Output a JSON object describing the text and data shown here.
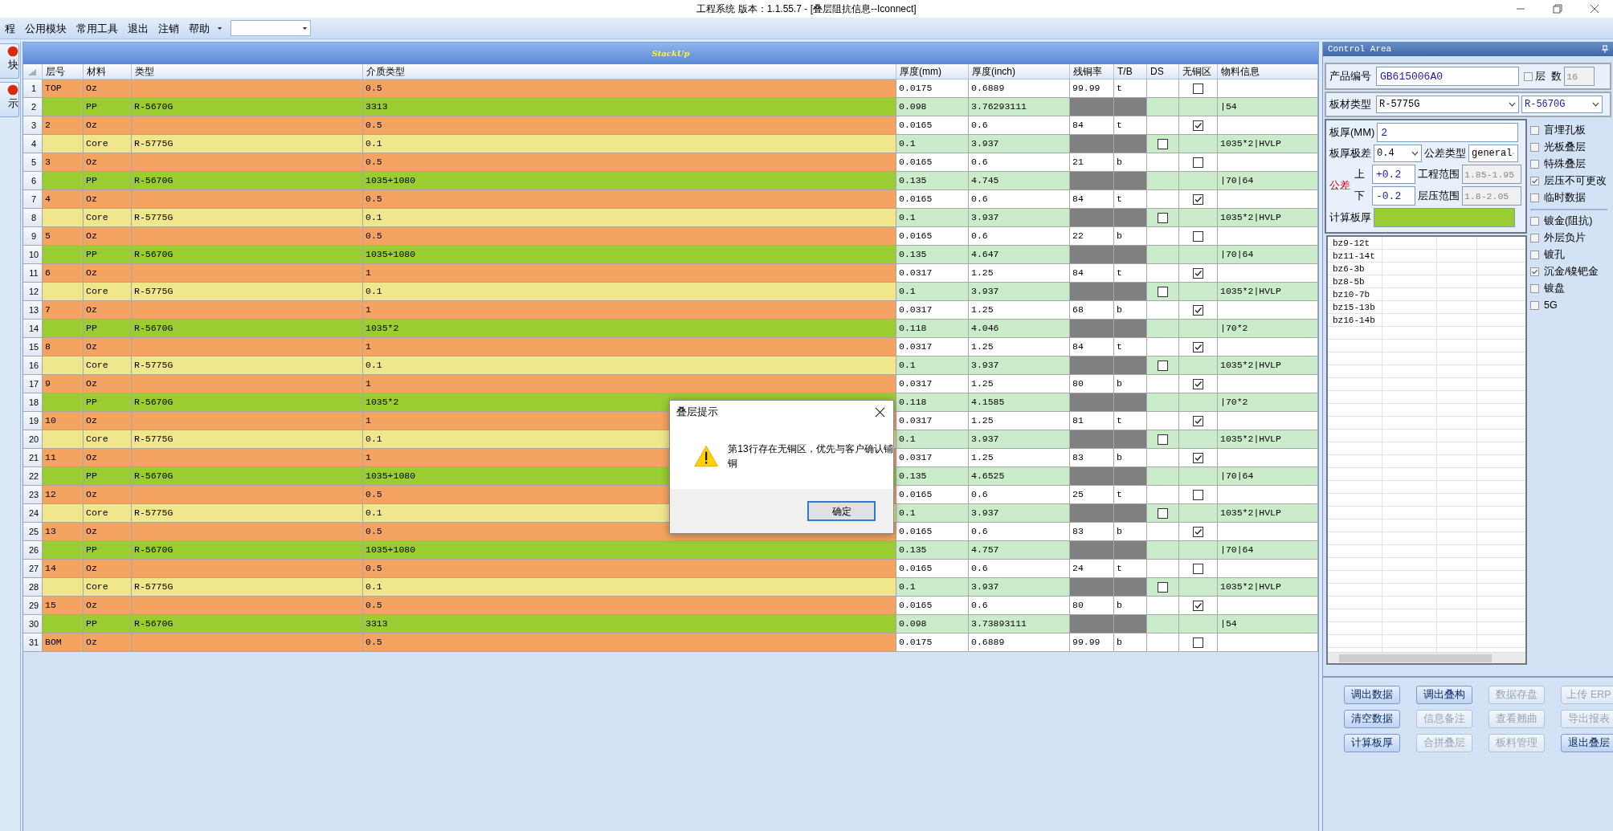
{
  "window": {
    "title": "工程系统   版本：1.1.55.7 - [叠层阻抗信息--Iconnect]"
  },
  "menu": [
    {
      "label": "程",
      "dropdown": false
    },
    {
      "label": "公用模块",
      "dropdown": false
    },
    {
      "label": "常用工具",
      "dropdown": false
    },
    {
      "label": "退出",
      "dropdown": false
    },
    {
      "label": "注销",
      "dropdown": false
    },
    {
      "label": "帮助",
      "dropdown": true
    }
  ],
  "side_buttons": [
    {
      "label": "块"
    },
    {
      "label": "示"
    }
  ],
  "stackup": {
    "title": "StackUp",
    "columns": [
      "层号",
      "材料",
      "类型",
      "介质类型",
      "厚度(mm)",
      "厚度(inch)",
      "残铜率",
      "T/B",
      "DS",
      "无铜区",
      "物料信息"
    ],
    "rows": [
      {
        "num": "1",
        "kind": "copper",
        "layer": "TOP",
        "material": "Oz",
        "dielectric": "0.5",
        "thick_mm": "0.0175",
        "thick_inch": "0.6889",
        "copper_rate": "99.99",
        "tb": "t",
        "no_copper": false
      },
      {
        "num": "2",
        "kind": "prepreg",
        "material": "PP",
        "type": "R-5670G",
        "dielectric": "3313",
        "thick_mm": "0.098",
        "thick_inch": "3.76293111",
        "info": "|54"
      },
      {
        "num": "3",
        "kind": "copper",
        "layer": "2",
        "material": "Oz",
        "dielectric": "0.5",
        "thick_mm": "0.0165",
        "thick_inch": "0.6",
        "copper_rate": "84",
        "tb": "t",
        "no_copper": true
      },
      {
        "num": "4",
        "kind": "core",
        "material": "Core",
        "type": "R-5775G",
        "dielectric": "0.1",
        "thick_mm": "0.1",
        "thick_inch": "3.937",
        "ds": false,
        "info": "1035*2|HVLP"
      },
      {
        "num": "5",
        "kind": "copper",
        "layer": "3",
        "material": "Oz",
        "dielectric": "0.5",
        "thick_mm": "0.0165",
        "thick_inch": "0.6",
        "copper_rate": "21",
        "tb": "b",
        "no_copper": false
      },
      {
        "num": "6",
        "kind": "prepreg",
        "material": "PP",
        "type": "R-5670G",
        "dielectric": "1035+1080",
        "thick_mm": "0.135",
        "thick_inch": "4.745",
        "info": "|70|64"
      },
      {
        "num": "7",
        "kind": "copper",
        "layer": "4",
        "material": "Oz",
        "dielectric": "0.5",
        "thick_mm": "0.0165",
        "thick_inch": "0.6",
        "copper_rate": "84",
        "tb": "t",
        "no_copper": true
      },
      {
        "num": "8",
        "kind": "core",
        "material": "Core",
        "type": "R-5775G",
        "dielectric": "0.1",
        "thick_mm": "0.1",
        "thick_inch": "3.937",
        "ds": false,
        "info": "1035*2|HVLP"
      },
      {
        "num": "9",
        "kind": "copper",
        "layer": "5",
        "material": "Oz",
        "dielectric": "0.5",
        "thick_mm": "0.0165",
        "thick_inch": "0.6",
        "copper_rate": "22",
        "tb": "b",
        "no_copper": false
      },
      {
        "num": "10",
        "kind": "prepreg",
        "material": "PP",
        "type": "R-5670G",
        "dielectric": "1035+1080",
        "thick_mm": "0.135",
        "thick_inch": "4.647",
        "info": "|70|64"
      },
      {
        "num": "11",
        "kind": "copper",
        "layer": "6",
        "material": "Oz",
        "dielectric": "1",
        "thick_mm": "0.0317",
        "thick_inch": "1.25",
        "copper_rate": "84",
        "tb": "t",
        "no_copper": true
      },
      {
        "num": "12",
        "kind": "core",
        "material": "Core",
        "type": "R-5775G",
        "dielectric": "0.1",
        "thick_mm": "0.1",
        "thick_inch": "3.937",
        "ds": false,
        "info": "1035*2|HVLP"
      },
      {
        "num": "13",
        "kind": "copper",
        "layer": "7",
        "material": "Oz",
        "dielectric": "1",
        "thick_mm": "0.0317",
        "thick_inch": "1.25",
        "copper_rate": "68",
        "tb": "b",
        "no_copper": true
      },
      {
        "num": "14",
        "kind": "prepreg",
        "material": "PP",
        "type": "R-5670G",
        "dielectric": "1035*2",
        "thick_mm": "0.118",
        "thick_inch": "4.046",
        "info": "|70*2"
      },
      {
        "num": "15",
        "kind": "copper",
        "layer": "8",
        "material": "Oz",
        "dielectric": "1",
        "thick_mm": "0.0317",
        "thick_inch": "1.25",
        "copper_rate": "84",
        "tb": "t",
        "no_copper": true
      },
      {
        "num": "16",
        "kind": "core",
        "material": "Core",
        "type": "R-5775G",
        "dielectric": "0.1",
        "thick_mm": "0.1",
        "thick_inch": "3.937",
        "ds": false,
        "info": "1035*2|HVLP"
      },
      {
        "num": "17",
        "kind": "copper",
        "layer": "9",
        "material": "Oz",
        "dielectric": "1",
        "thick_mm": "0.0317",
        "thick_inch": "1.25",
        "copper_rate": "80",
        "tb": "b",
        "no_copper": true
      },
      {
        "num": "18",
        "kind": "prepreg",
        "material": "PP",
        "type": "R-5670G",
        "dielectric": "1035*2",
        "thick_mm": "0.118",
        "thick_inch": "4.1585",
        "info": "|70*2"
      },
      {
        "num": "19",
        "kind": "copper",
        "layer": "10",
        "material": "Oz",
        "dielectric": "1",
        "thick_mm": "0.0317",
        "thick_inch": "1.25",
        "copper_rate": "81",
        "tb": "t",
        "no_copper": true
      },
      {
        "num": "20",
        "kind": "core",
        "material": "Core",
        "type": "R-5775G",
        "dielectric": "0.1",
        "thick_mm": "0.1",
        "thick_inch": "3.937",
        "ds": false,
        "info": "1035*2|HVLP"
      },
      {
        "num": "21",
        "kind": "copper",
        "layer": "11",
        "material": "Oz",
        "dielectric": "1",
        "thick_mm": "0.0317",
        "thick_inch": "1.25",
        "copper_rate": "83",
        "tb": "b",
        "no_copper": true
      },
      {
        "num": "22",
        "kind": "prepreg",
        "material": "PP",
        "type": "R-5670G",
        "dielectric": "1035+1080",
        "thick_mm": "0.135",
        "thick_inch": "4.6525",
        "info": "|70|64"
      },
      {
        "num": "23",
        "kind": "copper",
        "layer": "12",
        "material": "Oz",
        "dielectric": "0.5",
        "thick_mm": "0.0165",
        "thick_inch": "0.6",
        "copper_rate": "25",
        "tb": "t",
        "no_copper": false
      },
      {
        "num": "24",
        "kind": "core",
        "material": "Core",
        "type": "R-5775G",
        "dielectric": "0.1",
        "thick_mm": "0.1",
        "thick_inch": "3.937",
        "ds": false,
        "info": "1035*2|HVLP"
      },
      {
        "num": "25",
        "kind": "copper",
        "layer": "13",
        "material": "Oz",
        "dielectric": "0.5",
        "thick_mm": "0.0165",
        "thick_inch": "0.6",
        "copper_rate": "83",
        "tb": "b",
        "no_copper": true
      },
      {
        "num": "26",
        "kind": "prepreg",
        "material": "PP",
        "type": "R-5670G",
        "dielectric": "1035+1080",
        "thick_mm": "0.135",
        "thick_inch": "4.757",
        "info": "|70|64"
      },
      {
        "num": "27",
        "kind": "copper",
        "layer": "14",
        "material": "Oz",
        "dielectric": "0.5",
        "thick_mm": "0.0165",
        "thick_inch": "0.6",
        "copper_rate": "24",
        "tb": "t",
        "no_copper": false
      },
      {
        "num": "28",
        "kind": "core",
        "material": "Core",
        "type": "R-5775G",
        "dielectric": "0.1",
        "thick_mm": "0.1",
        "thick_inch": "3.937",
        "ds": false,
        "info": "1035*2|HVLP"
      },
      {
        "num": "29",
        "kind": "copper",
        "layer": "15",
        "material": "Oz",
        "dielectric": "0.5",
        "thick_mm": "0.0165",
        "thick_inch": "0.6",
        "copper_rate": "80",
        "tb": "b",
        "no_copper": true
      },
      {
        "num": "30",
        "kind": "prepreg",
        "material": "PP",
        "type": "R-5670G",
        "dielectric": "3313",
        "thick_mm": "0.098",
        "thick_inch": "3.73893111",
        "info": "|54"
      },
      {
        "num": "31",
        "kind": "copper",
        "layer": "BOM",
        "material": "Oz",
        "dielectric": "0.5",
        "thick_mm": "0.0175",
        "thick_inch": "0.6889",
        "copper_rate": "99.99",
        "tb": "b",
        "no_copper": false
      }
    ]
  },
  "dialog": {
    "title": "叠层提示",
    "message": "第13行存在无铜区，优先与客户确认铺铜",
    "button": "确定"
  },
  "control_area": {
    "title": "Control Area",
    "product_label": "产品编号",
    "product_no": "GB615006A0",
    "layer_count": {
      "label": "层  数",
      "checked": false,
      "value": "16"
    },
    "board_label": "板材类型",
    "board_type_1": "R-5775G",
    "board_type_2": "R-5670G",
    "thickness_label": "板厚(MM)",
    "thickness": "2",
    "range_label": "板厚极差",
    "range": "0.4",
    "tol_type_label": "公差类型",
    "tol_type": "general",
    "tol_label": "公差",
    "upper_label": "上",
    "upper": "+0.2",
    "lower_label": "下",
    "lower": "-0.2",
    "eng_label": "工程范围",
    "eng_range": "1.85-1.95",
    "lam_label": "层压范围",
    "lam_range": "1.8-2.05",
    "calc_label": "计算板厚",
    "option_groups": [
      [
        {
          "label": "盲埋孔板",
          "checked": false
        },
        {
          "label": "光板叠层",
          "checked": false
        },
        {
          "label": "特殊叠层",
          "checked": false
        },
        {
          "label": "层压不可更改",
          "checked": true
        },
        {
          "label": "临时数据",
          "checked": false
        }
      ],
      [
        {
          "label": "镀金(阻抗)",
          "checked": false
        },
        {
          "label": "外层负片",
          "checked": false
        },
        {
          "label": "镀孔",
          "checked": false
        },
        {
          "label": "沉金/镍钯金",
          "checked": true
        },
        {
          "label": "镀盘",
          "checked": false
        },
        {
          "label": "5G",
          "checked": false
        }
      ]
    ],
    "list_items": [
      "bz9-12t",
      "bz11-14t",
      "bz6-3b",
      "bz8-5b",
      "bz10-7b",
      "bz15-13b",
      "bz16-14b"
    ],
    "buttons": [
      {
        "label": "调出数据",
        "disabled": false
      },
      {
        "label": "调出叠构",
        "disabled": false
      },
      {
        "label": "数据存盘",
        "disabled": true
      },
      {
        "label": "上传 ERP",
        "disabled": true
      },
      {
        "label": "清空数据",
        "disabled": false
      },
      {
        "label": "信息备注",
        "disabled": true
      },
      {
        "label": "查看翘曲",
        "disabled": true
      },
      {
        "label": "导出报表",
        "disabled": true
      },
      {
        "label": "计算板厚",
        "disabled": false
      },
      {
        "label": "合拼叠层",
        "disabled": true
      },
      {
        "label": "板料管理",
        "disabled": true
      },
      {
        "label": "退出叠层",
        "disabled": false
      }
    ]
  }
}
